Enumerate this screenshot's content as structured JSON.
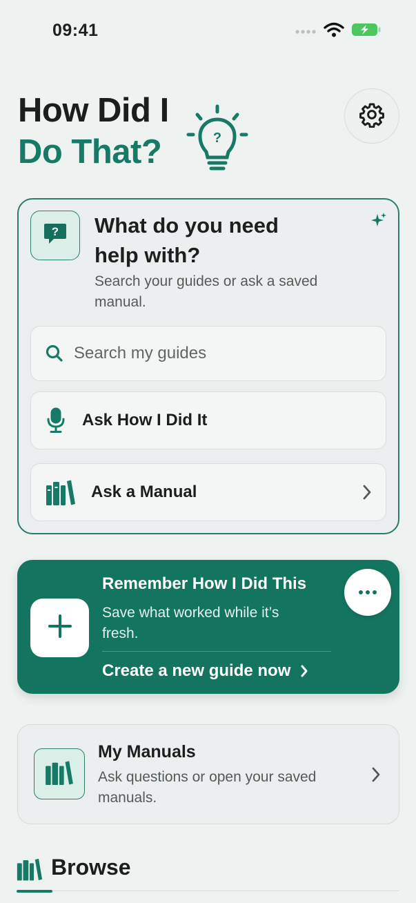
{
  "status_bar": {
    "time": "09:41",
    "icons": [
      "cellular-dots-icon",
      "wifi-icon",
      "battery-charging-icon"
    ]
  },
  "header": {
    "title_line1": "How Did I",
    "title_line2": "Do That?",
    "logo_icon": "lightbulb-question-icon",
    "settings_icon": "gear-icon"
  },
  "help_card": {
    "title": "What do you need help with?",
    "subtitle": "Search your guides or ask a saved manual.",
    "icon": "question-chat-icon",
    "sparkle_icon": "sparkle-icon",
    "search": {
      "placeholder": "Search my guides",
      "icon": "search-icon"
    },
    "ask_button": {
      "label": "Ask How I Did It",
      "icon": "microphone-icon"
    },
    "manual_button": {
      "label": "Ask a Manual",
      "icon": "books-icon"
    }
  },
  "remember_card": {
    "title": "Remember How I Did This",
    "subtitle": "Save what worked while it’s fresh.",
    "cta": "Create a new guide now",
    "icon": "plus-icon",
    "more_icon": "more-dots-icon"
  },
  "manuals_card": {
    "title": "My Manuals",
    "subtitle": "Ask questions or open your saved manuals.",
    "icon": "books-icon"
  },
  "browse": {
    "title": "Browse",
    "icon": "books-icon"
  },
  "colors": {
    "accent": "#167a66",
    "card_green": "#137460",
    "background": "#eef2f0"
  }
}
